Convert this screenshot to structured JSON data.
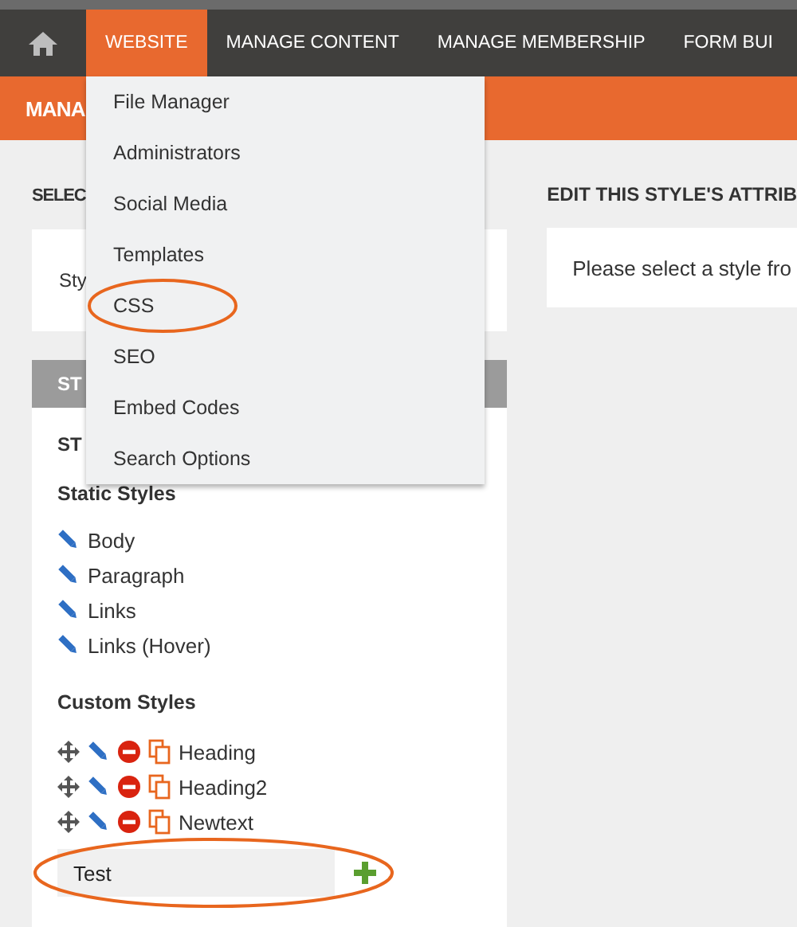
{
  "nav": {
    "items": [
      {
        "label": "WEBSITE",
        "selected": true
      },
      {
        "label": "MANAGE CONTENT",
        "selected": false
      },
      {
        "label": "MANAGE MEMBERSHIP",
        "selected": false
      },
      {
        "label": "FORM BUI",
        "selected": false
      }
    ]
  },
  "dropdown": {
    "items": [
      {
        "label": "File Manager",
        "highlighted": false
      },
      {
        "label": "Administrators",
        "highlighted": false
      },
      {
        "label": "Social Media",
        "highlighted": false
      },
      {
        "label": "Templates",
        "highlighted": false
      },
      {
        "label": "CSS",
        "highlighted": true
      },
      {
        "label": "SEO",
        "highlighted": false
      },
      {
        "label": "Embed Codes",
        "highlighted": false
      },
      {
        "label": "Search Options",
        "highlighted": false
      }
    ]
  },
  "page_header": {
    "title": "MANA"
  },
  "left": {
    "select_heading": "SELEC",
    "select_box_text": "Sty",
    "tab_label": "ST",
    "panel_heading": "ST",
    "static_heading": "Static Styles",
    "static_styles": [
      "Body",
      "Paragraph",
      "Links",
      "Links (Hover)"
    ],
    "custom_heading": "Custom Styles",
    "custom_styles": [
      "Heading",
      "Heading2",
      "Newtext"
    ],
    "new_style": {
      "value": "Test",
      "highlighted": true
    }
  },
  "right": {
    "heading": "EDIT THIS STYLE'S ATTRIB",
    "message": "Please select a style fro"
  }
}
